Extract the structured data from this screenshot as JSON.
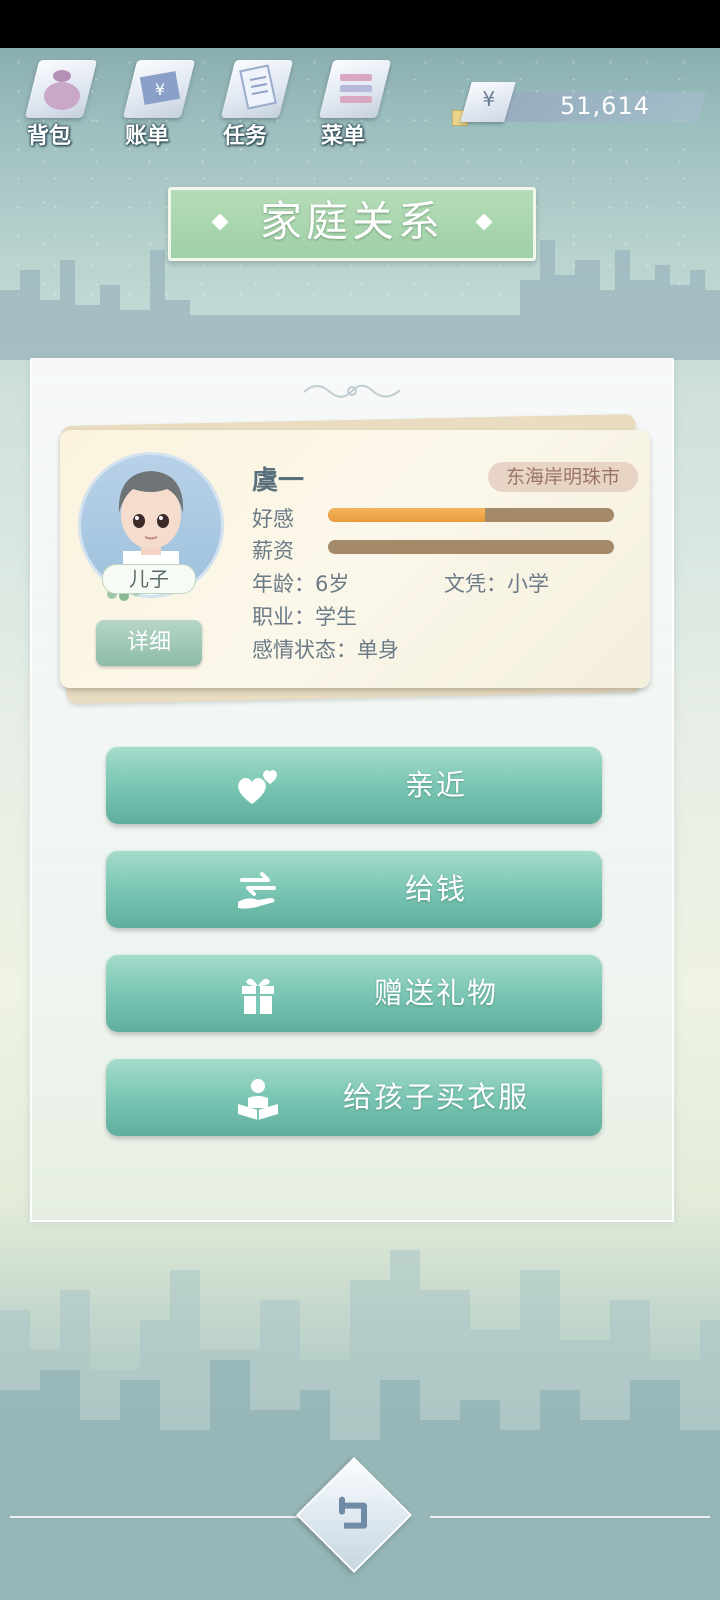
{
  "toolbar": {
    "items": [
      {
        "label": "背包",
        "icon": "bag-icon"
      },
      {
        "label": "账单",
        "icon": "bill-icon"
      },
      {
        "label": "任务",
        "icon": "task-icon"
      },
      {
        "label": "菜单",
        "icon": "menu-icon"
      }
    ]
  },
  "wallet": {
    "currency_symbol": "¥",
    "amount": "51,614"
  },
  "page": {
    "title": "家庭关系"
  },
  "member": {
    "name": "虞一",
    "relation": "儿子",
    "location": "东海岸明珠市",
    "detail_label": "详细",
    "favor_label": "好感",
    "favor_level": 0.55,
    "salary_label": "薪资",
    "salary_level": 0.0,
    "age_text": "年龄：6岁",
    "education_text": "文凭：小学",
    "job_text": "职业：学生",
    "relationship_text": "感情状态：单身"
  },
  "actions": [
    {
      "label": "亲近",
      "icon": "hearts-icon"
    },
    {
      "label": "给钱",
      "icon": "give-money-icon"
    },
    {
      "label": "赠送礼物",
      "icon": "gift-icon"
    },
    {
      "label": "给孩子买衣服",
      "icon": "reading-child-icon"
    }
  ],
  "colors": {
    "accent_green": "#7bc6b4",
    "favor_bar": "#f0a648",
    "bar_track": "#a58a6a"
  }
}
